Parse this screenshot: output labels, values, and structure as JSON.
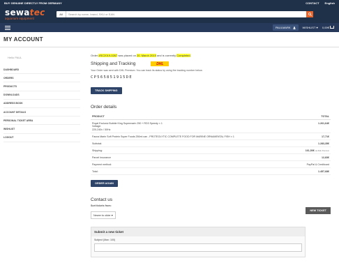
{
  "topbar": {
    "left": "BUY GENUINE DIRECTLY FROM GERMANY",
    "contact": "CONTACT",
    "language": "English"
  },
  "logo": {
    "brand": "sewa",
    "brand_accent": "tec",
    "tagline": "aquarium equipment"
  },
  "search": {
    "category": "All",
    "placeholder": "Search by name, brand, SKU or EAN"
  },
  "navbar": {
    "user": "PAULMARK",
    "wishlist": "WISHLIST",
    "cart_total": "0,00€"
  },
  "page_title": "MY ACCOUNT",
  "sidebar": {
    "user_label": "Hello PAUL",
    "items": [
      {
        "label": "DASHBOARD"
      },
      {
        "label": "ORDERS"
      },
      {
        "label": "PRODUCTS"
      },
      {
        "label": "DOWNLOADS"
      },
      {
        "label": "ADDRESS BOOK"
      },
      {
        "label": "ACCOUNT DETAILS"
      },
      {
        "label": "PERSONAL TICKET AREA"
      },
      {
        "label": "WISHLIST"
      },
      {
        "label": "LOGOUT"
      }
    ]
  },
  "order_notice": {
    "prefix": "Order ",
    "order_no": "#SC2019-0267",
    "mid1": " was placed on ",
    "date": "20. March 2019",
    "mid2": " and is currently ",
    "status": "Completed",
    "suffix": "."
  },
  "shipping": {
    "title": "Shipping and Tracking",
    "carrier": "DHL",
    "note": "Your Order was sent with DHL Premium. You can track its status by using the tracking number below.",
    "tracking_no": "CP565851915DE",
    "button": "TRACK SHIPPING"
  },
  "order_details": {
    "title": "Order details",
    "headers": [
      "PRODUCT",
      "TOTAL"
    ],
    "items": [
      {
        "name": "Royal Exclusiv Bubble King Supermarin 250 + RD3 Speedy × 1",
        "meta1": "Voltage:",
        "meta2": "220-240v / 50Hz",
        "total": "1.261,64€"
      },
      {
        "name": "Fauna Marin Soft Protein Super Foods 250ml can - PROTEOLYTIC COMPLETE FOOD FOR MARINE ORNAMENTAL FISH × 1",
        "meta1": "",
        "meta2": "",
        "total": "17,71€"
      }
    ],
    "summary": [
      {
        "label": "Subtotal:",
        "value": "1.283,35€",
        "note": ""
      },
      {
        "label": "Shipping:",
        "value": "161,50€",
        "note": "via DHL Premium"
      },
      {
        "label": "Parcel Insurance",
        "value": "12,83€",
        "note": ""
      },
      {
        "label": "Payment method:",
        "value": "PayPal & Creditcard",
        "note": ""
      },
      {
        "label": "Total:",
        "value": "1.457,68€",
        "note": ""
      }
    ],
    "order_again": "ORDER AGAIN"
  },
  "contact": {
    "title": "Contact us",
    "sort_label": "Sort tickets from:",
    "sort_value": "Newer to older",
    "new_ticket": "NEW TICKET",
    "submit_title": "Submit a new ticket",
    "subject_label": "Subject (Max: 100)"
  }
}
